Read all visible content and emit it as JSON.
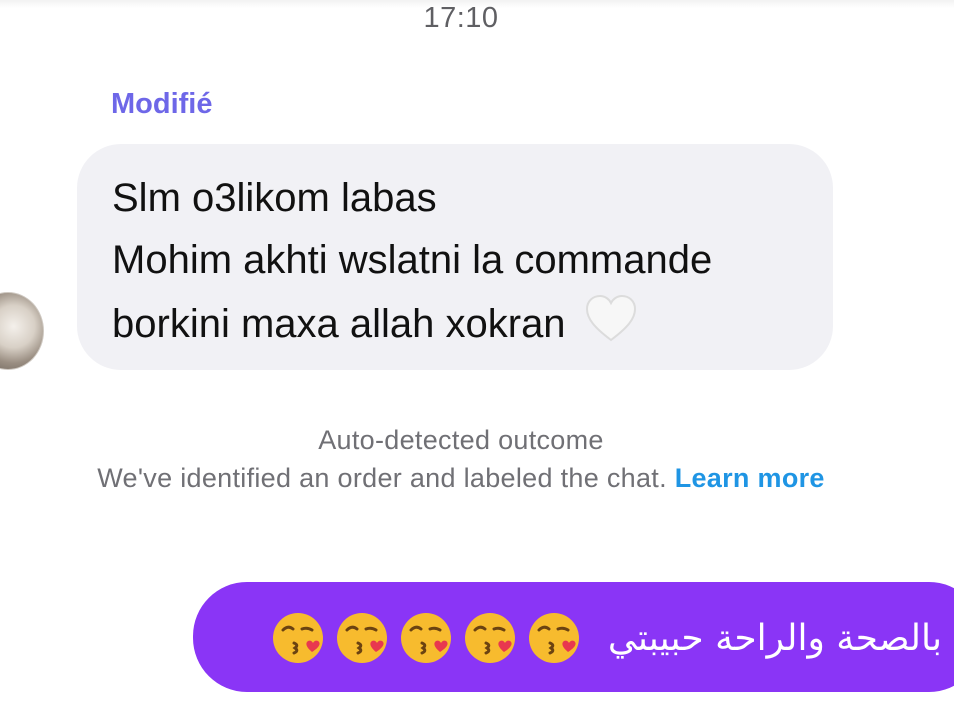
{
  "timestamp": "17:10",
  "received_message": {
    "edited_label": "Modifié",
    "lines": [
      "Slm o3likom labas",
      "Mohim akhti wslatni la commande",
      "borkini maxa allah xokran"
    ],
    "trailing_icon": "white-heart-icon"
  },
  "notice": {
    "title": "Auto-detected outcome",
    "body": "We've identified an order and labeled the chat.",
    "link_label": "Learn more",
    "link_color": "#1f95e4"
  },
  "sent_message": {
    "text": "بالصحة والراحة حبيبتي",
    "emoji_icon": "face-blowing-kiss-icon",
    "emoji_count": 5,
    "bubble_color": "#8a35f6"
  },
  "colors": {
    "received_bubble": "#f1f1f5",
    "edited_label": "#6e67e8"
  }
}
